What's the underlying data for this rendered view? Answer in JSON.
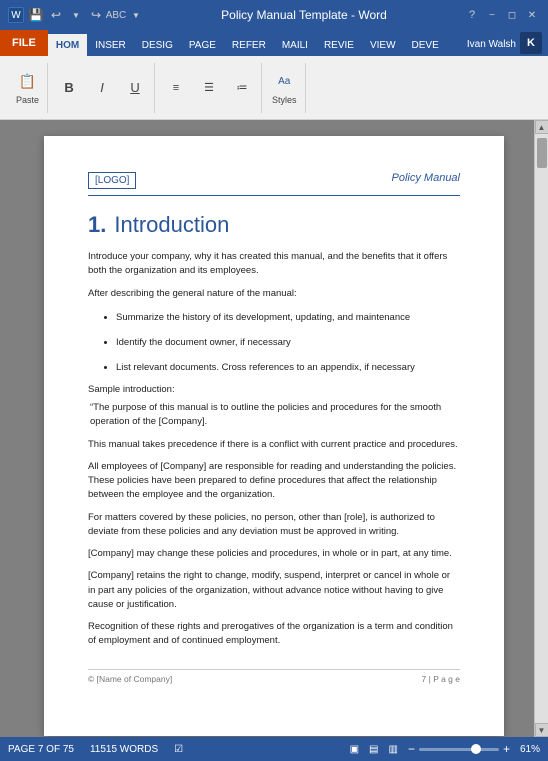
{
  "titlebar": {
    "title": "Policy Manual Template - Word",
    "icons": [
      "save",
      "undo",
      "redo",
      "spelling"
    ],
    "window_controls": [
      "minimize",
      "restore",
      "close"
    ],
    "help_icon": "?"
  },
  "ribbon": {
    "file_tab": "FILE",
    "tabs": [
      "HOM",
      "INSER",
      "DESIG",
      "PAGE",
      "REFER",
      "MAILI",
      "REVIE",
      "VIEW",
      "DEVE"
    ],
    "active_tab": "HOM",
    "user": {
      "name": "Ivan Walsh",
      "avatar": "K"
    }
  },
  "document": {
    "header": {
      "logo": "[LOGO]",
      "title": "Policy Manual"
    },
    "chapter": {
      "number": "1.",
      "title": "Introduction"
    },
    "paragraphs": [
      "Introduce your company, why it has created this manual, and the benefits that it offers both the organization and its employees.",
      "After describing the general nature of the manual:"
    ],
    "bullets": [
      "Summarize the history of its development, updating, and maintenance",
      "Identify the document owner, if necessary",
      "List relevant documents. Cross references to an appendix, if necessary"
    ],
    "sample_label": "Sample introduction:",
    "quote": "“The purpose of this manual is to outline the policies and procedures for the smooth operation of the [Company].",
    "body_paragraphs": [
      "This manual takes precedence if there is a conflict with current practice and procedures.",
      "All employees of [Company] are responsible for reading and understanding the policies. These policies have been prepared to define procedures that affect the relationship between the employee and the organization.",
      "For matters covered by these policies, no person, other than [role], is authorized to deviate from these policies and any deviation must be approved in writing.",
      "[Company] may change these policies and procedures, in whole or in part, at any time.",
      "[Company] retains the right to change, modify, suspend, interpret or cancel in whole or in part any policies of the organization, without advance notice without having to give cause or justification.",
      "Recognition of these rights and prerogatives of the organization is a term and condition of employment and of continued employment."
    ],
    "footer": {
      "company": "© [Name of Company]",
      "page": "7 | P a g e"
    }
  },
  "statusbar": {
    "page_info": "PAGE 7 OF 75",
    "word_count": "11515 WORDS",
    "view_icons": [
      "document-view",
      "read-view",
      "web-view"
    ],
    "zoom": "61%",
    "zoom_level": 61
  }
}
